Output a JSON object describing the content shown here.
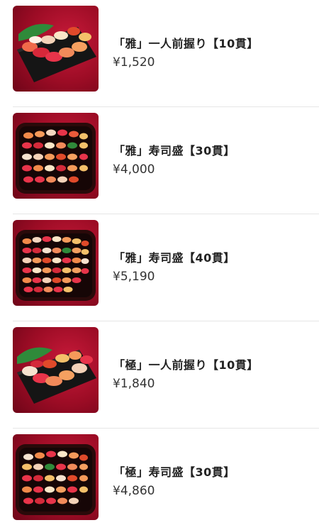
{
  "products": [
    {
      "name": "「雅」一人前握り【10貫】",
      "price": "¥1,520",
      "image": "sushi-plate-10-icon",
      "accent": "#a3102c"
    },
    {
      "name": "「雅」寿司盛【30貫】",
      "price": "¥4,000",
      "image": "sushi-platter-30-icon",
      "accent": "#a3102c"
    },
    {
      "name": "「雅」寿司盛【40貫】",
      "price": "¥5,190",
      "image": "sushi-platter-40-icon",
      "accent": "#a3102c"
    },
    {
      "name": "「極」一人前握り【10貫】",
      "price": "¥1,840",
      "image": "sushi-plate-10-icon",
      "accent": "#a3102c"
    },
    {
      "name": "「極」寿司盛【30貫】",
      "price": "¥4,860",
      "image": "sushi-platter-30-icon",
      "accent": "#a3102c"
    }
  ]
}
